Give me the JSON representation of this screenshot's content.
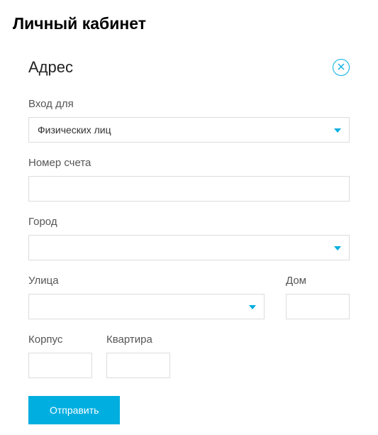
{
  "page": {
    "title": "Личный кабинет"
  },
  "form": {
    "title": "Адрес",
    "fields": {
      "entry_for": {
        "label": "Вход для",
        "value": "Физических лиц"
      },
      "account_number": {
        "label": "Номер счета",
        "value": ""
      },
      "city": {
        "label": "Город",
        "value": ""
      },
      "street": {
        "label": "Улица",
        "value": ""
      },
      "house": {
        "label": "Дом",
        "value": ""
      },
      "building": {
        "label": "Корпус",
        "value": ""
      },
      "apartment": {
        "label": "Квартира",
        "value": ""
      }
    },
    "submit_label": "Отправить"
  },
  "colors": {
    "accent": "#00aee0"
  }
}
